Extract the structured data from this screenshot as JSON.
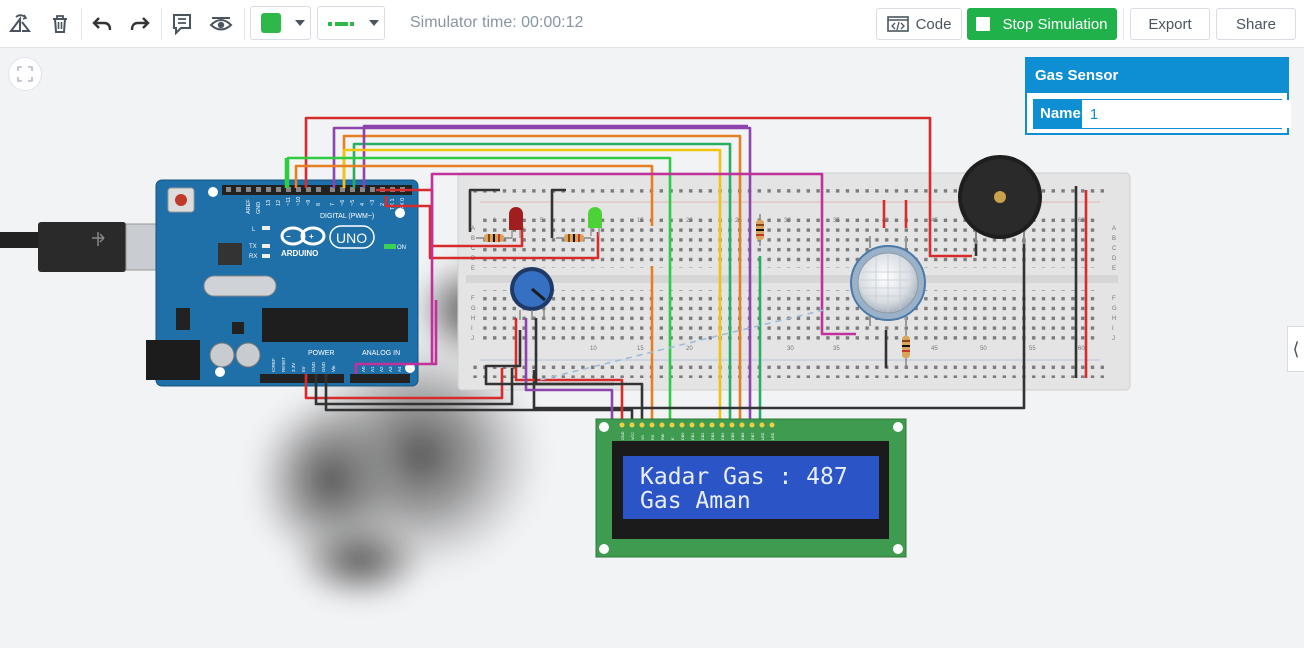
{
  "toolbar": {
    "sim_time_label": "Simulator time: 00:00:12",
    "code_label": "Code",
    "stop_label": "Stop Simulation",
    "export_label": "Export",
    "share_label": "Share",
    "icons": [
      "rotate-icon",
      "trash-icon",
      "undo-icon",
      "redo-icon",
      "notes-icon",
      "visibility-icon"
    ],
    "color_value": "#2fb84a",
    "wire_style_value": "dash"
  },
  "inspector": {
    "title": "Gas Sensor",
    "name_label": "Name",
    "name_value": "1"
  },
  "lcd": {
    "line1": "Kadar Gas : 487",
    "line2": "Gas Aman"
  },
  "arduino": {
    "brand": "ARDUINO",
    "model": "UNO",
    "digital_label": "DIGITAL (PWM~)",
    "power_label": "POWER",
    "analog_label": "ANALOG IN",
    "on_label": "ON",
    "l_label": "L",
    "tx_label": "TX",
    "rx_label": "RX",
    "aref_label": "AREF",
    "gnd_label": "GND",
    "pin_labels": [
      "13",
      "12",
      "~11",
      "~10",
      "~9",
      "8",
      "7",
      "~6",
      "~5",
      "4",
      "~3",
      "2",
      "TX 1",
      "RX 0"
    ],
    "power_pins": [
      "IOREF",
      "RESET",
      "3.3V",
      "5V",
      "GND",
      "GND",
      "Vin"
    ],
    "analog_pins": [
      "A0",
      "A1",
      "A2",
      "A3",
      "A4",
      "A5"
    ]
  },
  "breadboard": {
    "col_numbers": [
      "1",
      "5",
      "10",
      "15",
      "20",
      "25",
      "30",
      "35",
      "40",
      "45",
      "50",
      "55",
      "60"
    ],
    "row_letters_top": [
      "A",
      "B",
      "C",
      "D",
      "E"
    ],
    "row_letters_bottom": [
      "F",
      "G",
      "H",
      "I",
      "J"
    ]
  },
  "lcd_pins": [
    "GND",
    "VCC",
    "V0",
    "RS",
    "RW",
    "E",
    "DB0",
    "DB1",
    "DB2",
    "DB3",
    "DB4",
    "DB5",
    "DB6",
    "DB7",
    "LED",
    "LED"
  ],
  "colors": {
    "accent_blue": "#0e8fd4",
    "stop_green": "#21b14b",
    "lcd_bg": "#2b55c7",
    "board_blue": "#1f6fa8",
    "pcb_green": "#3f9b4f"
  }
}
